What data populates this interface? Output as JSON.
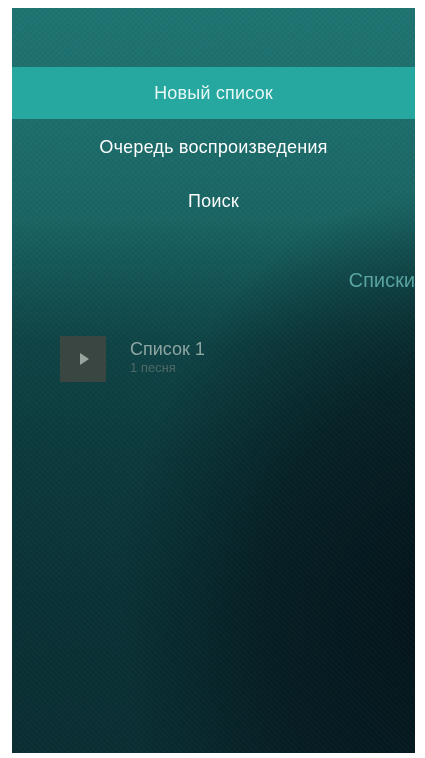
{
  "menu": {
    "items": [
      {
        "label": "Новый список",
        "active": true
      },
      {
        "label": "Очередь воспроизведения",
        "active": false
      },
      {
        "label": "Поиск",
        "active": false
      }
    ]
  },
  "section": {
    "title": "Списки"
  },
  "playlists": [
    {
      "title": "Список 1",
      "subtitle": "1 песня",
      "icon": "play-icon"
    }
  ],
  "colors": {
    "accent": "#26a8a0",
    "section_title": "#5da9a6",
    "background_top": "#1f7472",
    "background_bottom": "#0a2e33"
  }
}
